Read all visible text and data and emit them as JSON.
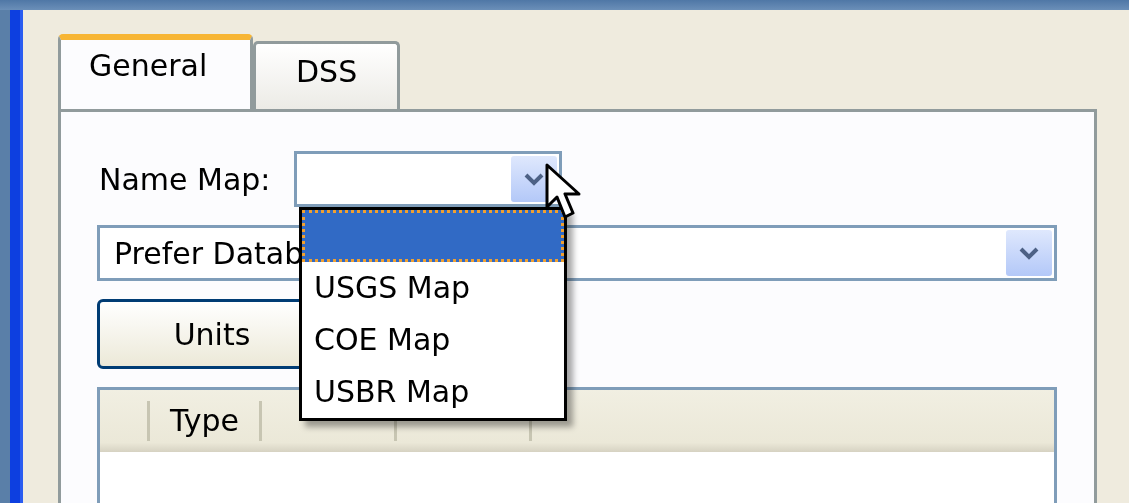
{
  "tabs": [
    {
      "label": "General",
      "selected": true
    },
    {
      "label": "DSS",
      "selected": false
    }
  ],
  "name_map": {
    "label": "Name Map:",
    "expanded": true,
    "options": [
      {
        "selected": true
      },
      {
        "label": "USGS Map",
        "selected": false
      },
      {
        "label": "COE Map",
        "selected": false
      },
      {
        "label": "USBR Map",
        "selected": false
      }
    ]
  },
  "preference_combo": {
    "value": "Prefer Datab"
  },
  "units_button": "Units",
  "table": {
    "columns": [
      "Type"
    ]
  }
}
